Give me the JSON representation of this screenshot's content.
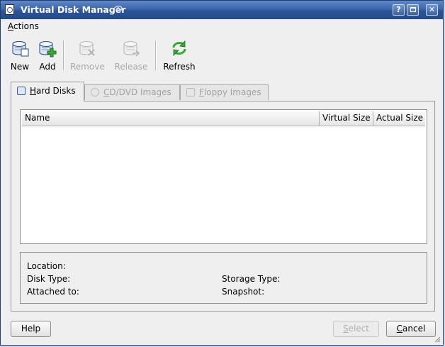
{
  "window": {
    "title": "Virtual Disk Manager"
  },
  "title_buttons": {
    "help": "?",
    "close": "✕"
  },
  "menu": {
    "actions_mnemonic": "A",
    "actions_rest": "ctions"
  },
  "toolbar": {
    "new": {
      "label": "New",
      "icon": "new-disk-icon",
      "enabled": true
    },
    "add": {
      "label": "Add",
      "icon": "add-disk-icon",
      "enabled": true
    },
    "remove": {
      "label": "Remove",
      "icon": "remove-disk-icon",
      "enabled": false
    },
    "release": {
      "label": "Release",
      "icon": "release-disk-icon",
      "enabled": false
    },
    "refresh": {
      "label": "Refresh",
      "icon": "refresh-icon",
      "enabled": true
    }
  },
  "tabs": {
    "hard_disks": {
      "mnemonic": "H",
      "rest": "ard Disks",
      "active": true
    },
    "cd_dvd": {
      "pre": "",
      "mnemonic": "C",
      "rest": "D/DVD Images",
      "active": false
    },
    "floppy": {
      "mnemonic": "F",
      "rest": "loppy Images",
      "active": false
    }
  },
  "list": {
    "columns": [
      "Name",
      "Virtual Size",
      "Actual Size"
    ],
    "rows": []
  },
  "info": {
    "location": "Location:",
    "disk_type": "Disk Type:",
    "attached_to": "Attached to:",
    "storage_type": "Storage Type:",
    "snapshot": "Snapshot:"
  },
  "buttons": {
    "help": "Help",
    "select_mnemonic": "S",
    "select_rest": "elect",
    "cancel_mnemonic": "C",
    "cancel_rest": "ancel"
  },
  "colors": {
    "titlebar": "#3d66aa",
    "window_bg": "#efefef",
    "refresh_green": "#3aa83a",
    "disabled_text": "#a9a9a9"
  }
}
